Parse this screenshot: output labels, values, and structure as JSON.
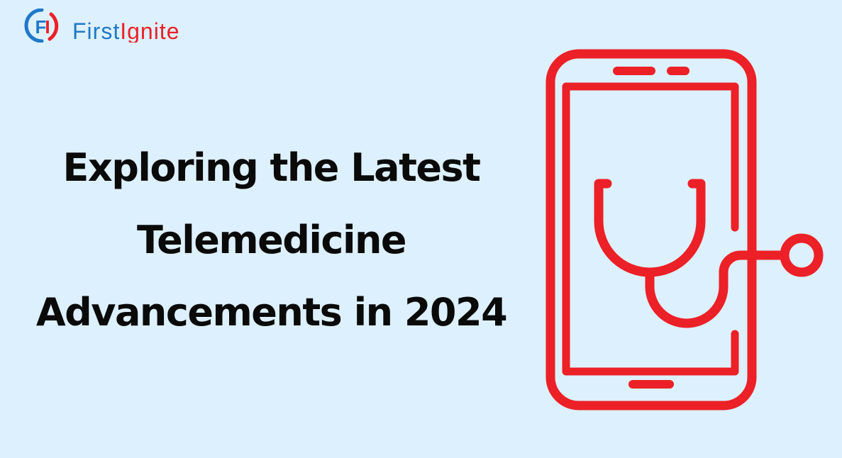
{
  "brand": {
    "logo_mark": "FI",
    "name_first": "First",
    "name_second": "Ignite",
    "colors": {
      "blue": "#1f79c9",
      "red": "#ec2027"
    }
  },
  "headline": {
    "line1": "Exploring the Latest",
    "line2": "Telemedicine",
    "line3": "Advancements in 2024"
  },
  "illustration": {
    "icon": "smartphone-stethoscope-icon",
    "color": "#ec2027"
  },
  "colors": {
    "background": "#ddf0fd",
    "text": "#0a0a0a"
  }
}
